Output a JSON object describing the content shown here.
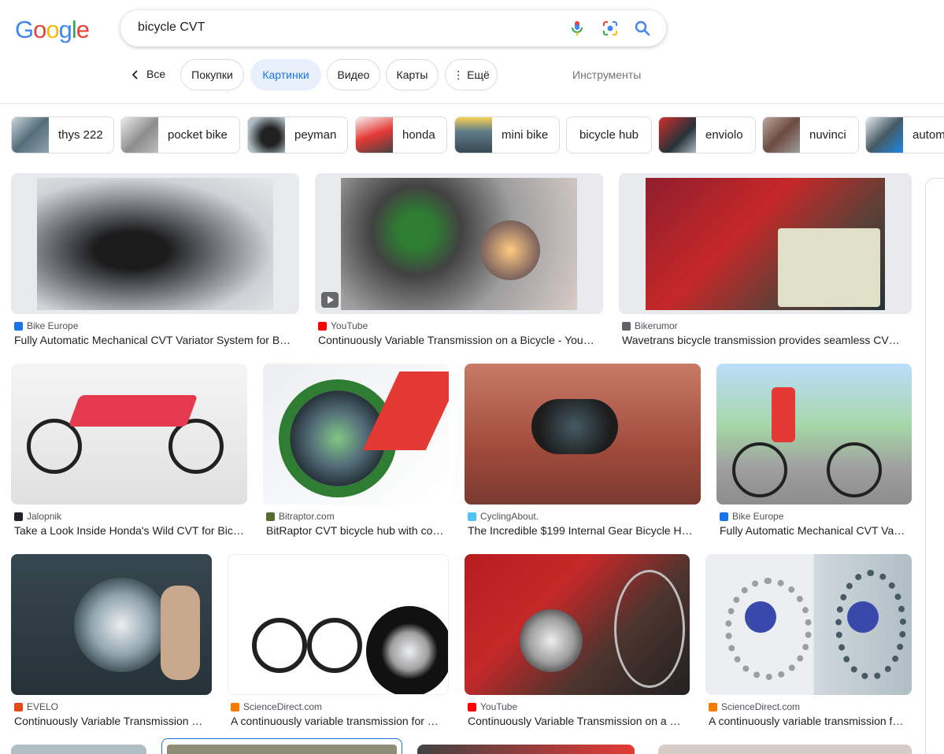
{
  "logo": {
    "letters": [
      "G",
      "o",
      "o",
      "g",
      "l",
      "e"
    ],
    "colors": [
      "#4285f4",
      "#ea4335",
      "#fbbc05",
      "#4285f4",
      "#34a853",
      "#ea4335"
    ]
  },
  "search": {
    "query": "bicycle  CVT"
  },
  "tabs": {
    "all": "Все",
    "chips": [
      "Покупки",
      "Картинки",
      "Видео",
      "Карты",
      "⋮ Ещё"
    ],
    "active": "Картинки",
    "tools": "Инструменты"
  },
  "related": [
    "thys 222",
    "pocket bike",
    "peyman",
    "honda",
    "mini bike",
    "bicycle hub",
    "enviolo",
    "nuvinci",
    "autom"
  ],
  "results": [
    {
      "source": "Bike Europe",
      "title": "Fully Automatic Mechanical CVT Variator System for B…",
      "fav": "#1a73e8",
      "video": false
    },
    {
      "source": "YouTube",
      "title": "Continuously Variable Transmission on a Bicycle - You…",
      "fav": "#ff0000",
      "video": true
    },
    {
      "source": "Bikerumor",
      "title": "Wavetrans bicycle transmission provides seamless CV…",
      "fav": "#5f6368",
      "video": false
    },
    {
      "source": "Jalopnik",
      "title": "Take a Look Inside Honda's Wild CVT for Bic…",
      "fav": "#202124",
      "video": false
    },
    {
      "source": "Bitraptor.com",
      "title": "BitRaptor CVT bicycle hub with co…",
      "fav": "#556b2f",
      "video": false
    },
    {
      "source": "CyclingAbout.",
      "title": "The Incredible $199 Internal Gear Bicycle H…",
      "fav": "#4fc3f7",
      "video": false
    },
    {
      "source": "Bike Europe",
      "title": "Fully Automatic Mechanical CVT Va…",
      "fav": "#1a73e8",
      "video": false
    },
    {
      "source": "EVELO",
      "title": "Continuously Variable Transmission …",
      "fav": "#e64a19",
      "video": false
    },
    {
      "source": "ScienceDirect.com",
      "title": "A continuously variable transmission for …",
      "fav": "#f57c00",
      "video": false
    },
    {
      "source": "YouTube",
      "title": "Continuously Variable Transmission on a …",
      "fav": "#ff0000",
      "video": false
    },
    {
      "source": "ScienceDirect.com",
      "title": "A continuously variable transmission f…",
      "fav": "#f57c00",
      "video": false
    }
  ]
}
